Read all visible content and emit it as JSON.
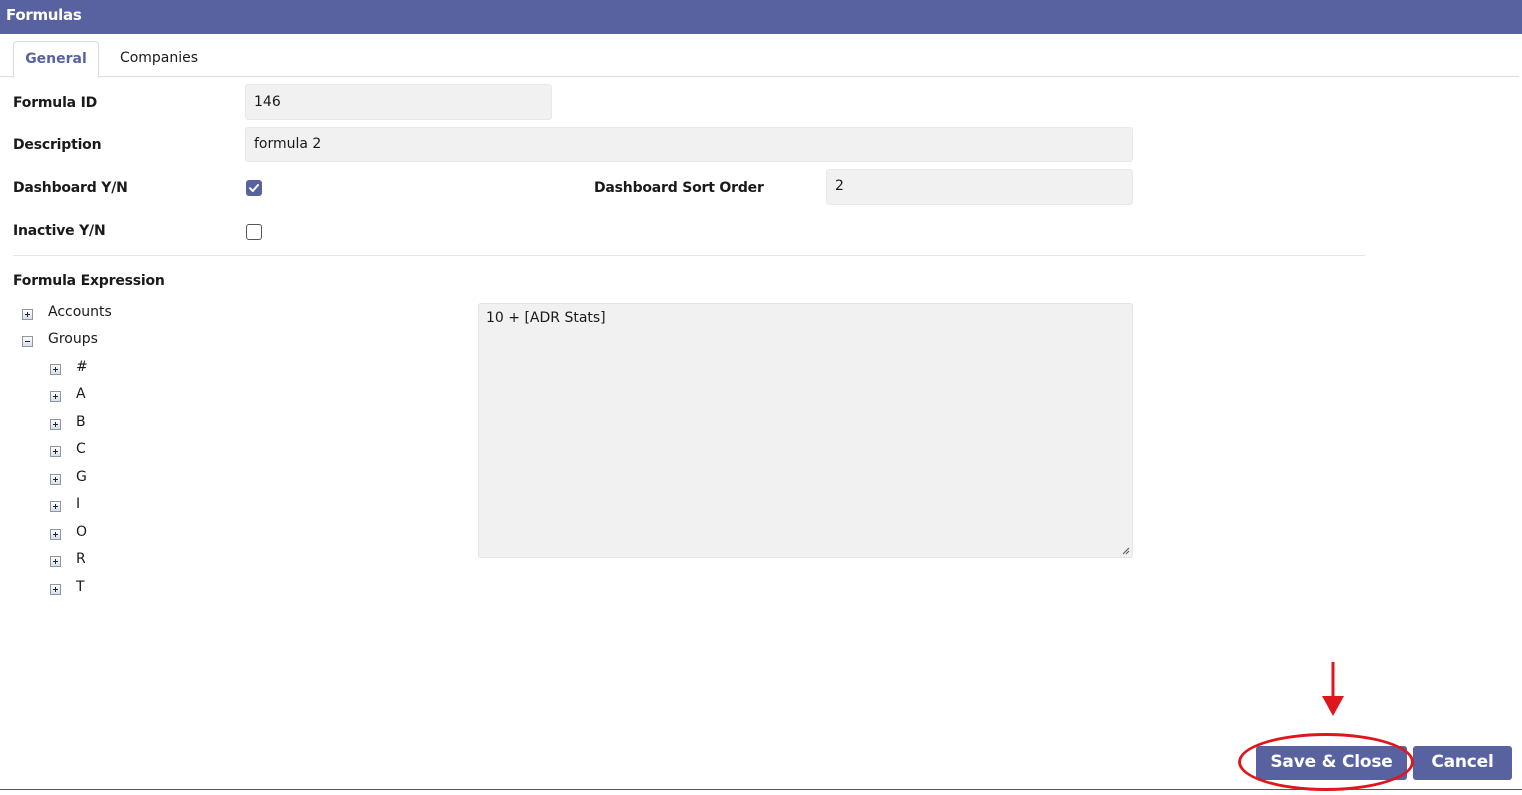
{
  "window": {
    "title": "Formulas"
  },
  "tabs": [
    {
      "label": "General",
      "active": true
    },
    {
      "label": "Companies",
      "active": false
    }
  ],
  "form": {
    "formula_id": {
      "label": "Formula ID",
      "value": "146"
    },
    "description": {
      "label": "Description",
      "value": "formula 2"
    },
    "dashboard_yn": {
      "label": "Dashboard Y/N",
      "checked": true
    },
    "dashboard_sort_order": {
      "label": "Dashboard Sort Order",
      "value": "2"
    },
    "inactive_yn": {
      "label": "Inactive Y/N",
      "checked": false
    },
    "formula_expression": {
      "label": "Formula Expression",
      "value": "10 + [ADR Stats]"
    }
  },
  "tree": {
    "items": [
      {
        "label": "Accounts",
        "expanded": false,
        "depth": 0
      },
      {
        "label": "Groups",
        "expanded": true,
        "depth": 0,
        "children": [
          {
            "label": "#",
            "expanded": false
          },
          {
            "label": "A",
            "expanded": false
          },
          {
            "label": "B",
            "expanded": false
          },
          {
            "label": "C",
            "expanded": false
          },
          {
            "label": "G",
            "expanded": false
          },
          {
            "label": "I",
            "expanded": false
          },
          {
            "label": "O",
            "expanded": false
          },
          {
            "label": "R",
            "expanded": false
          },
          {
            "label": "T",
            "expanded": false
          }
        ]
      }
    ]
  },
  "buttons": {
    "save_close": "Save & Close",
    "cancel": "Cancel"
  },
  "colors": {
    "accent": "#5862a0",
    "field_bg": "#f1f1f1",
    "highlight": "#e0161d"
  }
}
